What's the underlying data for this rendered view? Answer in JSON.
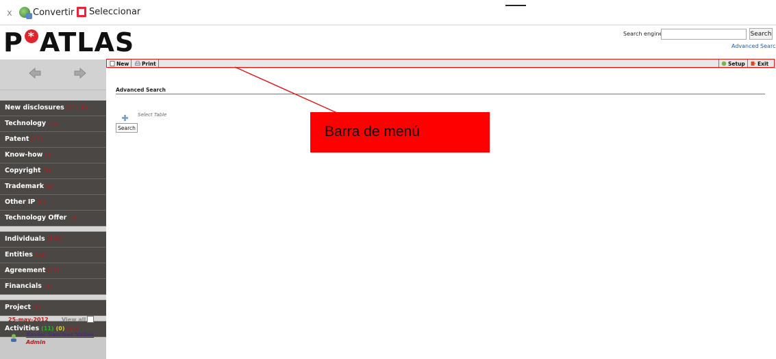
{
  "converter_bar": {
    "close": "x",
    "convert_label": "Convertir",
    "select_label": "Seleccionar"
  },
  "header": {
    "logo_left": "P",
    "logo_right": "ATLAS",
    "search_label": "Search engine",
    "search_value": "",
    "search_button": "Search",
    "advanced_link": "Advanced Search"
  },
  "toolbar": {
    "new_label": "New",
    "print_label": "Print",
    "setup_label": "Setup",
    "exit_label": "Exit"
  },
  "sidebar": {
    "groups": [
      [
        {
          "label": "New disclosures",
          "counts": [
            "(21)",
            "(8)"
          ]
        },
        {
          "label": "Technology",
          "counts": [
            "(11)"
          ]
        },
        {
          "label": "Patent",
          "counts": [
            "(12)"
          ]
        },
        {
          "label": "Know-how",
          "counts": [
            "(3)"
          ]
        },
        {
          "label": "Copyright",
          "counts": [
            "(1)"
          ]
        },
        {
          "label": "Trademark",
          "counts": [
            "(0)"
          ]
        },
        {
          "label": "Other IP",
          "counts": [
            "(0)"
          ]
        },
        {
          "label": "Technology Offer",
          "counts": [
            "(7)"
          ]
        }
      ],
      [
        {
          "label": "Individuals",
          "counts": [
            "(136)"
          ]
        },
        {
          "label": "Entities",
          "counts": [
            "(32)"
          ]
        },
        {
          "label": "Agreement",
          "counts": [
            "(17)"
          ]
        },
        {
          "label": "Financials",
          "counts": [
            "(3)"
          ]
        }
      ],
      [
        {
          "label": "Project",
          "counts": [
            "(0)"
          ]
        }
      ],
      [
        {
          "label": "Activities",
          "counts": [
            "(11)",
            "(0)",
            "(33)"
          ]
        }
      ]
    ],
    "date": "25-may-2012",
    "view_all": "View all",
    "user_name": "Xavier Sanchez Valive",
    "user_role": "Admin"
  },
  "main": {
    "section_title": "Advanced Search",
    "select_table": "Select Table",
    "search_button": "Search"
  },
  "annotation": {
    "label": "Barra de menú"
  },
  "colors": {
    "sidebar_item_bg": "#4a4744",
    "count_red": "#b31a1a",
    "annotation_red": "#ff0000",
    "logo_star": "#e0262c"
  },
  "icons": {
    "close": "close-icon",
    "convert": "pdf-convert-icon",
    "select": "select-icon",
    "back": "back-arrow-icon",
    "forward": "forward-arrow-icon",
    "new": "new-document-icon",
    "print": "printer-icon",
    "setup": "setup-icon",
    "exit": "exit-icon",
    "add": "plus-icon",
    "user": "user-icon"
  }
}
